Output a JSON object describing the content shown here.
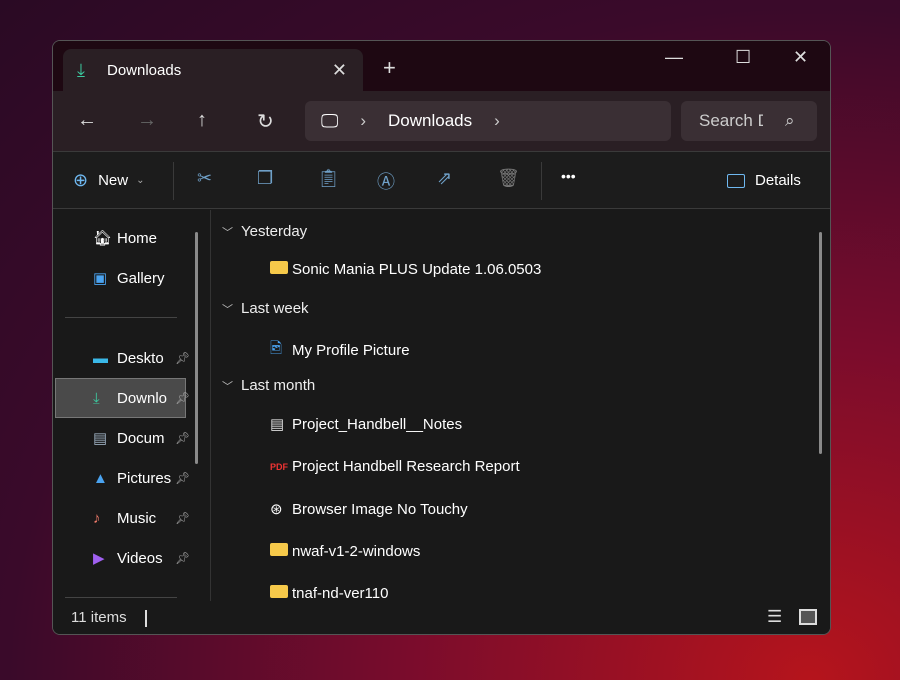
{
  "window": {
    "tab_title": "Downloads",
    "new_tab": "+",
    "minimize": "—",
    "maximize": "☐",
    "close": "✕"
  },
  "address": {
    "crumbs": [
      "Downloads"
    ],
    "search_placeholder": "Search D"
  },
  "toolbar": {
    "new_label": "New",
    "details_label": "Details",
    "more": "•••"
  },
  "sidebar": {
    "items": [
      {
        "label": "Home",
        "icon": "home-icon"
      },
      {
        "label": "Gallery",
        "icon": "gallery-icon"
      },
      {
        "label": "Deskto",
        "icon": "desktop-icon",
        "pinned": true
      },
      {
        "label": "Downlo",
        "icon": "download-icon",
        "pinned": true,
        "selected": true
      },
      {
        "label": "Docum",
        "icon": "documents-icon",
        "pinned": true
      },
      {
        "label": "Pictures",
        "icon": "pictures-icon",
        "pinned": true
      },
      {
        "label": "Music",
        "icon": "music-icon",
        "pinned": true
      },
      {
        "label": "Videos",
        "icon": "videos-icon",
        "pinned": true
      }
    ]
  },
  "groups": [
    {
      "label": "Yesterday",
      "files": [
        {
          "name": "Sonic Mania PLUS Update 1.06.0503",
          "icon": "folder-icon"
        }
      ]
    },
    {
      "label": "Last week",
      "files": [
        {
          "name": "My Profile Picture",
          "icon": "image-file-icon"
        }
      ]
    },
    {
      "label": "Last month",
      "files": [
        {
          "name": "Project_Handbell__Notes",
          "icon": "text-file-icon"
        },
        {
          "name": "Project Handbell Research Report",
          "icon": "pdf-icon"
        },
        {
          "name": "Browser Image No Touchy",
          "icon": "image-icon"
        },
        {
          "name": "nwaf-v1-2-windows",
          "icon": "folder-icon"
        },
        {
          "name": "tnaf-nd-ver110",
          "icon": "folder-icon"
        }
      ]
    }
  ],
  "status": {
    "count": "11 items"
  },
  "colors": {
    "accent": "#3ccaa0",
    "folder": "#f6c94a"
  }
}
